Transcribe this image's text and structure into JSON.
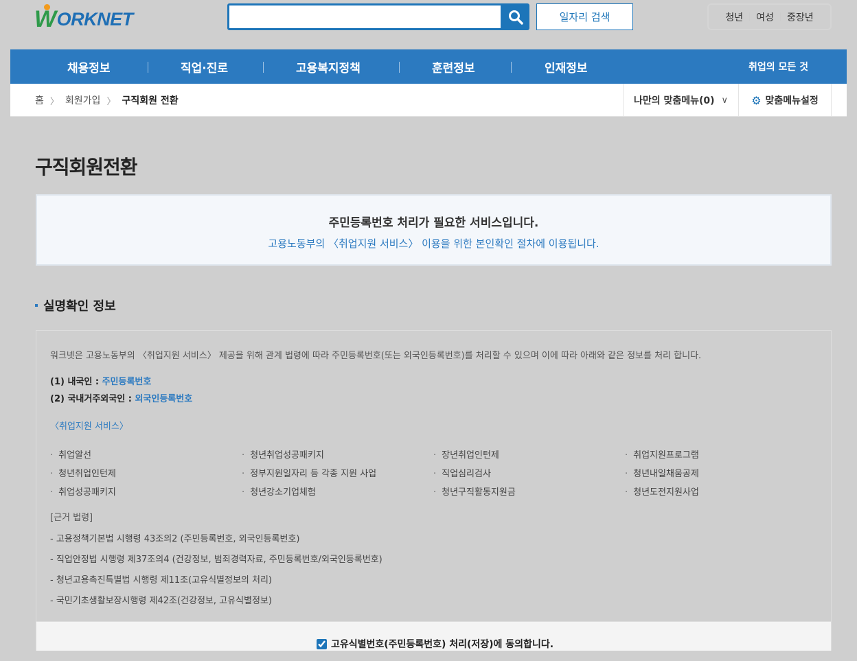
{
  "header": {
    "logo_text": "WORKNET",
    "search_value": "",
    "job_search_label": "일자리 검색",
    "targets": [
      "청년",
      "여성",
      "중장년"
    ]
  },
  "nav": {
    "items": [
      "채용정보",
      "직업·진로",
      "고용복지정책",
      "훈련정보",
      "인재정보"
    ],
    "right": "취업의 모든 것"
  },
  "breadcrumb": {
    "items": [
      "홈",
      "회원가입",
      "구직회원 전환"
    ]
  },
  "my_menu": "나만의 맞춤메뉴(0)",
  "menu_settings": "맞춤메뉴설정",
  "page_title": "구직회원전환",
  "notice": {
    "main": "주민등록번호 처리가 필요한 서비스입니다.",
    "sub": "고용노동부의 〈취업지원 서비스〉 이용을 위한 본인확인 절차에 이용됩니다."
  },
  "section_title": "실명확인 정보",
  "info": {
    "intro": "워크넷은 고용노동부의 〈취업지원 서비스〉 제공을 위해 관계 법령에 따라 주민등록번호(또는 외국인등록번호)를 처리할 수 있으며 이에 따라 아래와 같은 정보를 처리 합니다.",
    "domestic_label": "(1) 내국인 : ",
    "domestic_value": "주민등록번호",
    "foreign_label": "(2) 국내거주외국인 : ",
    "foreign_value": "외국인등록번호",
    "services_title": "〈취업지원 서비스〉",
    "services": [
      "취업알선",
      "청년취업성공패키지",
      "장년취업인턴제",
      "취업지원프로그램",
      "청년취업인턴제",
      "정부지원일자리 등 각종 지원 사업",
      "직업심리검사",
      "청년내일채움공제",
      "취업성공패키지",
      "청년강소기업체험",
      "청년구직활동지원금",
      "청년도전지원사업"
    ],
    "laws_title": "[근거 법령]",
    "laws": [
      "고용정책기본법 시행령 43조의2 (주민등록번호, 외국인등록번호)",
      "직업안정법 시행령 제37조의4 (건강정보, 범죄경력자료, 주민등록번호/외국인등록번호)",
      "청년고용촉진특별법 시행령 제11조(고유식별정보의 처리)",
      "국민기초생활보장시행령 제42조(건강정보, 고유식별정보)"
    ]
  },
  "agree": {
    "label": "고유식별번호(주민등록번호) 처리(저장)에 동의합니다.",
    "checked": true
  },
  "colors": {
    "brand_blue": "#2c7ac0",
    "logo_green": "#2e9a4a",
    "logo_orange": "#f29b1d"
  }
}
